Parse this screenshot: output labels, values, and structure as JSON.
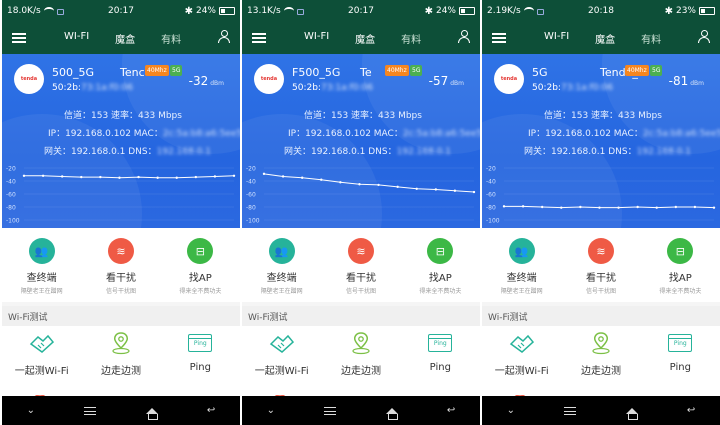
{
  "phones": [
    {
      "status": {
        "speed": "18.0K/s",
        "time": "20:17",
        "battery": "24%"
      },
      "tabs": [
        "WI-FI",
        "魔盒",
        "有料"
      ],
      "ssid_fragment": "500_5G",
      "ssid_fragment2": "Tenc",
      "band": "40Mhz",
      "freq": "5G",
      "signal": "-32",
      "signal_unit": "dBm",
      "mac_prefix": "50:2b:",
      "mac_suffix": "73:1a:f0:06",
      "channel_line": "信道：153 速率：433 Mbps",
      "ip_label": "IP：192.168.0.102  MAC：",
      "ip_mac_blur": "2c:5a:b8:a6:5ee5",
      "gw_label": "网关：192.168.0.1  DNS：",
      "dns_blur": "192.168.0.1",
      "ticks": [
        "-20",
        "-40",
        "-60",
        "-80",
        "-100"
      ],
      "chart_data": {
        "type": "line",
        "ylim": [
          -100,
          -20
        ],
        "values": [
          -32,
          -32,
          -33,
          -34,
          -34,
          -35,
          -34,
          -35,
          -35,
          -34,
          -33,
          -32
        ]
      }
    },
    {
      "status": {
        "speed": "13.1K/s",
        "time": "20:17",
        "battery": "24%"
      },
      "tabs": [
        "WI-FI",
        "魔盒",
        "有料"
      ],
      "ssid_fragment": "F500_5G",
      "ssid_fragment2": "Te",
      "band": "40Mhz",
      "freq": "5G",
      "signal": "-57",
      "signal_unit": "dBm",
      "mac_prefix": "50:2b:",
      "mac_suffix": "73:1a:f0:06",
      "channel_line": "信道：153 速率：433 Mbps",
      "ip_label": "IP：192.168.0.102  MAC：",
      "ip_mac_blur": "2c:5a:b8:a6:5ee5",
      "gw_label": "网关：192.168.0.1  DNS：",
      "dns_blur": "192.168.0.1",
      "ticks": [
        "-20",
        "-40",
        "-60",
        "-80",
        "-100"
      ],
      "chart_data": {
        "type": "line",
        "ylim": [
          -100,
          -20
        ],
        "values": [
          -29,
          -33,
          -35,
          -38,
          -42,
          -45,
          -46,
          -49,
          -52,
          -53,
          -55,
          -57
        ]
      }
    },
    {
      "status": {
        "speed": "2.19K/s",
        "time": "20:18",
        "battery": "23%"
      },
      "tabs": [
        "WI-FI",
        "魔盒",
        "有料"
      ],
      "ssid_fragment": "5G",
      "ssid_fragment2": "Tenda_3",
      "band": "40Mhz",
      "freq": "5G",
      "signal": "-81",
      "signal_unit": "dBm",
      "mac_prefix": "50:2b:",
      "mac_suffix": "73:1a:f0:06",
      "channel_line": "信道：153 速率：433 Mbps",
      "ip_label": "IP：192.168.0.102  MAC：",
      "ip_mac_blur": "2c:5a:b8:a6:5ee5",
      "gw_label": "网关：192.168.0.1  DNS：",
      "dns_blur": "192.168.0.1",
      "ticks": [
        "-20",
        "-40",
        "-60",
        "-80",
        "-100"
      ],
      "chart_data": {
        "type": "line",
        "ylim": [
          -100,
          -20
        ],
        "values": [
          -79,
          -79,
          -80,
          -81,
          -80,
          -81,
          -81,
          -80,
          -81,
          -80,
          -80,
          -81
        ]
      }
    }
  ],
  "actions": [
    {
      "label": "查终端",
      "sub": "隔壁老王在蹭网",
      "color": "#26b39a"
    },
    {
      "label": "看干扰",
      "sub": "信号干扰图",
      "color": "#ef5a45"
    },
    {
      "label": "找AP",
      "sub": "得来全不费功夫",
      "color": "#3cb846"
    }
  ],
  "section_title": "Wi-Fi测试",
  "tests": [
    {
      "label": "一起测Wi-Fi"
    },
    {
      "label": "边走边测"
    },
    {
      "label": "Ping",
      "icon_text": "Ping"
    }
  ],
  "logo_text": "tenda"
}
